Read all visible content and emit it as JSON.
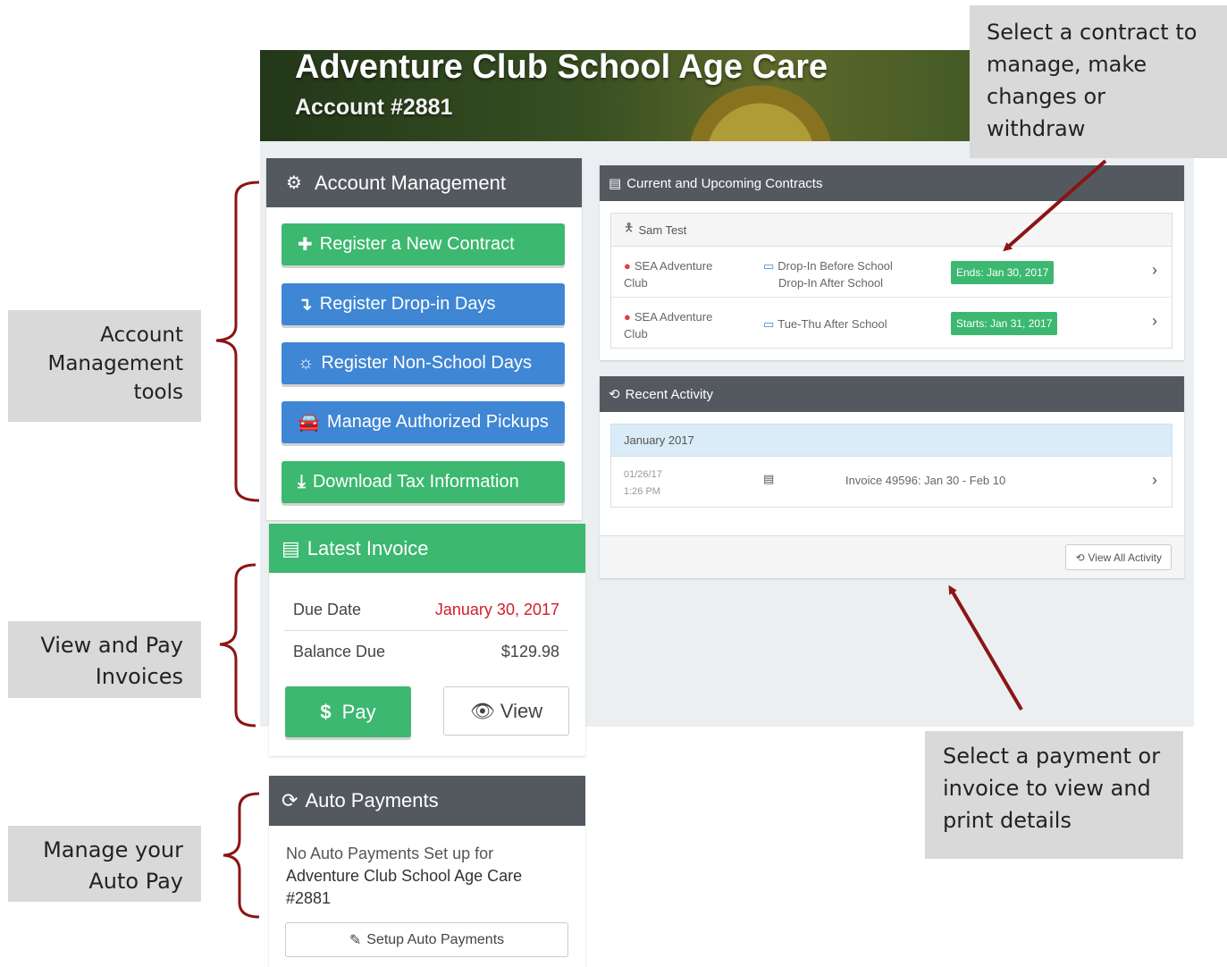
{
  "header": {
    "title": "Adventure Club School Age Care",
    "account": "Account #2881"
  },
  "account_management": {
    "title": "Account Management",
    "icon": "gear-icon",
    "buttons": [
      {
        "label": "Register a New Contract",
        "icon": "plus-icon",
        "color": "#3cb870"
      },
      {
        "label": "Register Drop-in Days",
        "icon": "arrow-down-icon",
        "color": "#3f86d4"
      },
      {
        "label": "Register Non-School Days",
        "icon": "sun-icon",
        "color": "#3f86d4"
      },
      {
        "label": "Manage Authorized Pickups",
        "icon": "car-icon",
        "color": "#3f86d4"
      },
      {
        "label": "Download Tax Information",
        "icon": "download-icon",
        "color": "#3cb870"
      }
    ]
  },
  "latest_invoice": {
    "title": "Latest Invoice",
    "due_date_label": "Due Date",
    "due_date_value": "January 30, 2017",
    "balance_label": "Balance Due",
    "balance_value": "$129.98",
    "pay_label": "Pay",
    "view_label": "View"
  },
  "auto_payments": {
    "title": "Auto Payments",
    "line1": "No Auto Payments Set up for",
    "line2": "Adventure Club School Age Care",
    "line3": "#2881",
    "setup_label": "Setup Auto Payments"
  },
  "contracts": {
    "title": "Current and Upcoming Contracts",
    "child_name": "Sam Test",
    "rows": [
      {
        "location_line1": "SEA Adventure",
        "location_line2": "Club",
        "program_line1": "Drop-In Before School",
        "program_line2": "Drop-In After School",
        "badge": "Ends: Jan 30, 2017"
      },
      {
        "location_line1": "SEA Adventure",
        "location_line2": "Club",
        "program_line1": "Tue-Thu After School",
        "program_line2": "",
        "badge": "Starts: Jan 31, 2017"
      }
    ]
  },
  "recent_activity": {
    "title": "Recent Activity",
    "month": "January 2017",
    "items": [
      {
        "date": "01/26/17",
        "time": "1:26 PM",
        "description": "Invoice 49596: Jan 30 - Feb 10"
      }
    ],
    "view_all_label": "View All Activity"
  },
  "annotations": {
    "account_tools": [
      "Account",
      "Management",
      "tools"
    ],
    "view_pay": [
      "View and Pay",
      "Invoices"
    ],
    "auto_pay": [
      "Manage your",
      "Auto Pay"
    ],
    "select_contract": [
      "Select a contract to",
      "manage, make",
      "changes or",
      "withdraw"
    ],
    "select_payment": [
      "Select a payment or",
      "invoice to view and",
      "print details"
    ]
  }
}
